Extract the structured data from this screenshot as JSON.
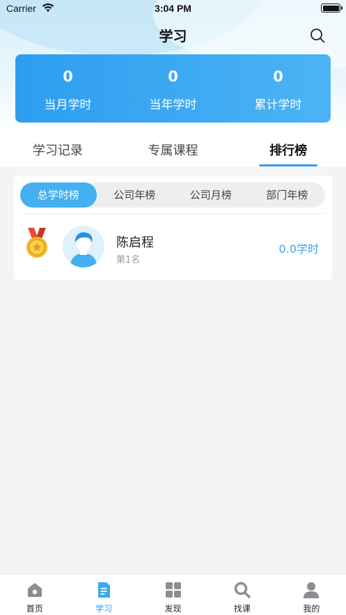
{
  "status_bar": {
    "carrier": "Carrier",
    "time": "3:04 PM"
  },
  "header": {
    "title": "学习",
    "search_icon": "search-icon"
  },
  "stats": [
    {
      "value": "0",
      "label": "当月学时"
    },
    {
      "value": "0",
      "label": "当年学时"
    },
    {
      "value": "0",
      "label": "累计学时"
    }
  ],
  "tabs": [
    {
      "label": "学习记录",
      "active": false
    },
    {
      "label": "专属课程",
      "active": false
    },
    {
      "label": "排行榜",
      "active": true
    }
  ],
  "ranking": {
    "segments": [
      {
        "label": "总学时榜",
        "active": true
      },
      {
        "label": "公司年榜",
        "active": false
      },
      {
        "label": "公司月榜",
        "active": false
      },
      {
        "label": "部门年榜",
        "active": false
      }
    ],
    "entries": [
      {
        "name": "陈启程",
        "rank_text": "第1名",
        "hours": "0.0学时",
        "medal_icon": "gold-medal-icon"
      }
    ]
  },
  "tabbar": [
    {
      "label": "首页",
      "icon": "home-icon",
      "active": false
    },
    {
      "label": "学习",
      "icon": "study-icon",
      "active": true
    },
    {
      "label": "发现",
      "icon": "discover-grid-icon",
      "active": false
    },
    {
      "label": "找课",
      "icon": "find-course-search-icon",
      "active": false
    },
    {
      "label": "我的",
      "icon": "profile-icon",
      "active": false
    }
  ],
  "colors": {
    "accent": "#2d9df0",
    "segment_active": "#44aff1",
    "hours_text": "#3aa8ee",
    "page_background": "#f4f4f5"
  }
}
